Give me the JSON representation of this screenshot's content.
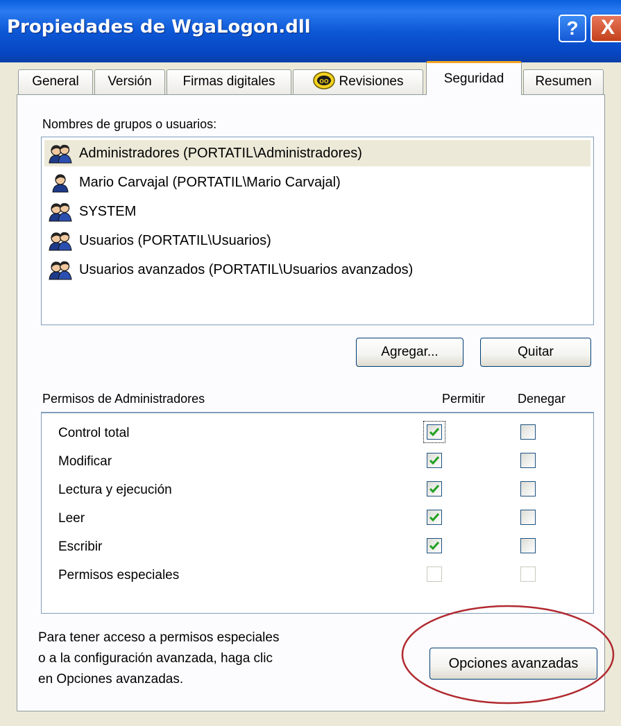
{
  "window": {
    "title": "Propiedades de WgaLogon.dll",
    "help_glyph": "?",
    "close_glyph": "X"
  },
  "tabs": [
    {
      "label": "General",
      "active": false
    },
    {
      "label": "Versión",
      "active": false
    },
    {
      "label": "Firmas digitales",
      "active": false
    },
    {
      "label": "Revisiones",
      "active": false,
      "icon": "revisions-badge-icon"
    },
    {
      "label": "Seguridad",
      "active": true
    },
    {
      "label": "Resumen",
      "active": false
    }
  ],
  "security": {
    "users_label": "Nombres de grupos o usuarios:",
    "users": [
      {
        "label": "Administradores (PORTATIL\\Administradores)",
        "icon": "user-group-icon",
        "selected": true
      },
      {
        "label": "Mario Carvajal (PORTATIL\\Mario Carvajal)",
        "icon": "user-icon",
        "selected": false
      },
      {
        "label": "SYSTEM",
        "icon": "user-group-icon",
        "selected": false
      },
      {
        "label": "Usuarios (PORTATIL\\Usuarios)",
        "icon": "user-group-icon",
        "selected": false
      },
      {
        "label": "Usuarios avanzados (PORTATIL\\Usuarios avanzados)",
        "icon": "user-group-icon",
        "selected": false
      }
    ],
    "add_button": "Agregar...",
    "remove_button": "Quitar",
    "perms_title": "Permisos de Administradores",
    "allow_header": "Permitir",
    "deny_header": "Denegar",
    "permissions": [
      {
        "label": "Control total",
        "allow": true,
        "deny": false,
        "enabled": true,
        "focused": true
      },
      {
        "label": "Modificar",
        "allow": true,
        "deny": false,
        "enabled": true
      },
      {
        "label": "Lectura y ejecución",
        "allow": true,
        "deny": false,
        "enabled": true
      },
      {
        "label": "Leer",
        "allow": true,
        "deny": false,
        "enabled": true
      },
      {
        "label": "Escribir",
        "allow": true,
        "deny": false,
        "enabled": true
      },
      {
        "label": "Permisos especiales",
        "allow": false,
        "deny": false,
        "enabled": false
      }
    ],
    "help_text_lines": [
      "Para tener acceso a permisos especiales",
      "o a la configuración avanzada, haga clic",
      "en Opciones avanzadas."
    ],
    "advanced_button": "Opciones avanzadas"
  },
  "colors": {
    "titlebar": "#0a5fdd",
    "active_tab_accent": "#f3a51f",
    "annotation": "#b02a30",
    "checkmark": "#21a121"
  }
}
